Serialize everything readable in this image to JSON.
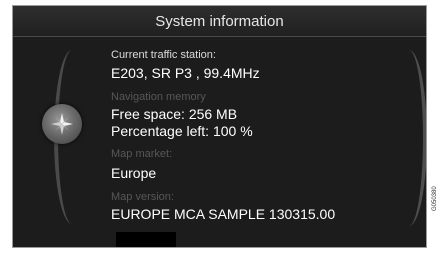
{
  "header": {
    "title": "System information"
  },
  "sections": [
    {
      "label": "Current traffic station:",
      "values": [
        "E203, SR P3   , 99.4MHz"
      ]
    },
    {
      "label": "Navigation memory",
      "values": [
        "Free space: 256 MB",
        "Percentage left: 100 %"
      ]
    },
    {
      "label": "Map market:",
      "values": [
        "Europe"
      ]
    },
    {
      "label": "Map version:",
      "values": [
        "EUROPE MCA SAMPLE 130315.00"
      ]
    }
  ],
  "figure_code": "G050380",
  "colors": {
    "screen_bg": "#1c1c1c",
    "label_active": "#dcdcdc",
    "label_dim": "#575757",
    "value": "#ffffff"
  }
}
